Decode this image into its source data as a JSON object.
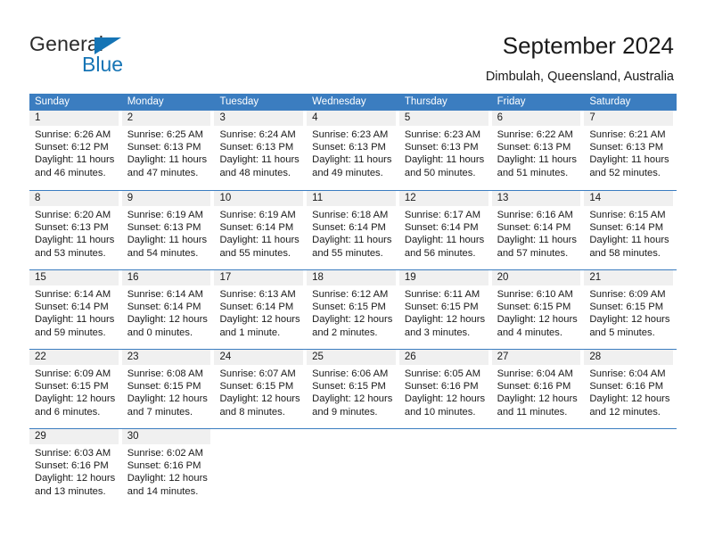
{
  "brand": {
    "name_top": "General",
    "name_bottom": "Blue",
    "accent_color": "#1574b5"
  },
  "header": {
    "title": "September 2024",
    "subtitle": "Dimbulah, Queensland, Australia"
  },
  "theme": {
    "header_bar_color": "#3b7dc0",
    "daynum_band_color": "#f0f0f0",
    "text_color": "#1a1a1a"
  },
  "calendar": {
    "weekday_headers": [
      "Sunday",
      "Monday",
      "Tuesday",
      "Wednesday",
      "Thursday",
      "Friday",
      "Saturday"
    ],
    "weeks": [
      [
        {
          "day": "1",
          "sunrise": "Sunrise: 6:26 AM",
          "sunset": "Sunset: 6:12 PM",
          "daylight_line1": "Daylight: 11 hours",
          "daylight_line2": "and 46 minutes."
        },
        {
          "day": "2",
          "sunrise": "Sunrise: 6:25 AM",
          "sunset": "Sunset: 6:13 PM",
          "daylight_line1": "Daylight: 11 hours",
          "daylight_line2": "and 47 minutes."
        },
        {
          "day": "3",
          "sunrise": "Sunrise: 6:24 AM",
          "sunset": "Sunset: 6:13 PM",
          "daylight_line1": "Daylight: 11 hours",
          "daylight_line2": "and 48 minutes."
        },
        {
          "day": "4",
          "sunrise": "Sunrise: 6:23 AM",
          "sunset": "Sunset: 6:13 PM",
          "daylight_line1": "Daylight: 11 hours",
          "daylight_line2": "and 49 minutes."
        },
        {
          "day": "5",
          "sunrise": "Sunrise: 6:23 AM",
          "sunset": "Sunset: 6:13 PM",
          "daylight_line1": "Daylight: 11 hours",
          "daylight_line2": "and 50 minutes."
        },
        {
          "day": "6",
          "sunrise": "Sunrise: 6:22 AM",
          "sunset": "Sunset: 6:13 PM",
          "daylight_line1": "Daylight: 11 hours",
          "daylight_line2": "and 51 minutes."
        },
        {
          "day": "7",
          "sunrise": "Sunrise: 6:21 AM",
          "sunset": "Sunset: 6:13 PM",
          "daylight_line1": "Daylight: 11 hours",
          "daylight_line2": "and 52 minutes."
        }
      ],
      [
        {
          "day": "8",
          "sunrise": "Sunrise: 6:20 AM",
          "sunset": "Sunset: 6:13 PM",
          "daylight_line1": "Daylight: 11 hours",
          "daylight_line2": "and 53 minutes."
        },
        {
          "day": "9",
          "sunrise": "Sunrise: 6:19 AM",
          "sunset": "Sunset: 6:13 PM",
          "daylight_line1": "Daylight: 11 hours",
          "daylight_line2": "and 54 minutes."
        },
        {
          "day": "10",
          "sunrise": "Sunrise: 6:19 AM",
          "sunset": "Sunset: 6:14 PM",
          "daylight_line1": "Daylight: 11 hours",
          "daylight_line2": "and 55 minutes."
        },
        {
          "day": "11",
          "sunrise": "Sunrise: 6:18 AM",
          "sunset": "Sunset: 6:14 PM",
          "daylight_line1": "Daylight: 11 hours",
          "daylight_line2": "and 55 minutes."
        },
        {
          "day": "12",
          "sunrise": "Sunrise: 6:17 AM",
          "sunset": "Sunset: 6:14 PM",
          "daylight_line1": "Daylight: 11 hours",
          "daylight_line2": "and 56 minutes."
        },
        {
          "day": "13",
          "sunrise": "Sunrise: 6:16 AM",
          "sunset": "Sunset: 6:14 PM",
          "daylight_line1": "Daylight: 11 hours",
          "daylight_line2": "and 57 minutes."
        },
        {
          "day": "14",
          "sunrise": "Sunrise: 6:15 AM",
          "sunset": "Sunset: 6:14 PM",
          "daylight_line1": "Daylight: 11 hours",
          "daylight_line2": "and 58 minutes."
        }
      ],
      [
        {
          "day": "15",
          "sunrise": "Sunrise: 6:14 AM",
          "sunset": "Sunset: 6:14 PM",
          "daylight_line1": "Daylight: 11 hours",
          "daylight_line2": "and 59 minutes."
        },
        {
          "day": "16",
          "sunrise": "Sunrise: 6:14 AM",
          "sunset": "Sunset: 6:14 PM",
          "daylight_line1": "Daylight: 12 hours",
          "daylight_line2": "and 0 minutes."
        },
        {
          "day": "17",
          "sunrise": "Sunrise: 6:13 AM",
          "sunset": "Sunset: 6:14 PM",
          "daylight_line1": "Daylight: 12 hours",
          "daylight_line2": "and 1 minute."
        },
        {
          "day": "18",
          "sunrise": "Sunrise: 6:12 AM",
          "sunset": "Sunset: 6:15 PM",
          "daylight_line1": "Daylight: 12 hours",
          "daylight_line2": "and 2 minutes."
        },
        {
          "day": "19",
          "sunrise": "Sunrise: 6:11 AM",
          "sunset": "Sunset: 6:15 PM",
          "daylight_line1": "Daylight: 12 hours",
          "daylight_line2": "and 3 minutes."
        },
        {
          "day": "20",
          "sunrise": "Sunrise: 6:10 AM",
          "sunset": "Sunset: 6:15 PM",
          "daylight_line1": "Daylight: 12 hours",
          "daylight_line2": "and 4 minutes."
        },
        {
          "day": "21",
          "sunrise": "Sunrise: 6:09 AM",
          "sunset": "Sunset: 6:15 PM",
          "daylight_line1": "Daylight: 12 hours",
          "daylight_line2": "and 5 minutes."
        }
      ],
      [
        {
          "day": "22",
          "sunrise": "Sunrise: 6:09 AM",
          "sunset": "Sunset: 6:15 PM",
          "daylight_line1": "Daylight: 12 hours",
          "daylight_line2": "and 6 minutes."
        },
        {
          "day": "23",
          "sunrise": "Sunrise: 6:08 AM",
          "sunset": "Sunset: 6:15 PM",
          "daylight_line1": "Daylight: 12 hours",
          "daylight_line2": "and 7 minutes."
        },
        {
          "day": "24",
          "sunrise": "Sunrise: 6:07 AM",
          "sunset": "Sunset: 6:15 PM",
          "daylight_line1": "Daylight: 12 hours",
          "daylight_line2": "and 8 minutes."
        },
        {
          "day": "25",
          "sunrise": "Sunrise: 6:06 AM",
          "sunset": "Sunset: 6:15 PM",
          "daylight_line1": "Daylight: 12 hours",
          "daylight_line2": "and 9 minutes."
        },
        {
          "day": "26",
          "sunrise": "Sunrise: 6:05 AM",
          "sunset": "Sunset: 6:16 PM",
          "daylight_line1": "Daylight: 12 hours",
          "daylight_line2": "and 10 minutes."
        },
        {
          "day": "27",
          "sunrise": "Sunrise: 6:04 AM",
          "sunset": "Sunset: 6:16 PM",
          "daylight_line1": "Daylight: 12 hours",
          "daylight_line2": "and 11 minutes."
        },
        {
          "day": "28",
          "sunrise": "Sunrise: 6:04 AM",
          "sunset": "Sunset: 6:16 PM",
          "daylight_line1": "Daylight: 12 hours",
          "daylight_line2": "and 12 minutes."
        }
      ],
      [
        {
          "day": "29",
          "sunrise": "Sunrise: 6:03 AM",
          "sunset": "Sunset: 6:16 PM",
          "daylight_line1": "Daylight: 12 hours",
          "daylight_line2": "and 13 minutes."
        },
        {
          "day": "30",
          "sunrise": "Sunrise: 6:02 AM",
          "sunset": "Sunset: 6:16 PM",
          "daylight_line1": "Daylight: 12 hours",
          "daylight_line2": "and 14 minutes."
        },
        {
          "day": "",
          "sunrise": "",
          "sunset": "",
          "daylight_line1": "",
          "daylight_line2": ""
        },
        {
          "day": "",
          "sunrise": "",
          "sunset": "",
          "daylight_line1": "",
          "daylight_line2": ""
        },
        {
          "day": "",
          "sunrise": "",
          "sunset": "",
          "daylight_line1": "",
          "daylight_line2": ""
        },
        {
          "day": "",
          "sunrise": "",
          "sunset": "",
          "daylight_line1": "",
          "daylight_line2": ""
        },
        {
          "day": "",
          "sunrise": "",
          "sunset": "",
          "daylight_line1": "",
          "daylight_line2": ""
        }
      ]
    ]
  }
}
